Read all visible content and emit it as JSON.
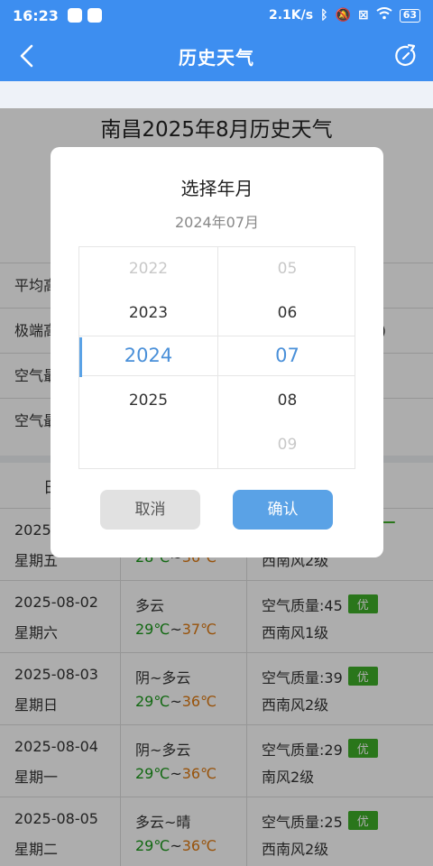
{
  "status_bar": {
    "time": "16:23",
    "network_speed": "2.1K/s",
    "battery": "63"
  },
  "nav": {
    "title": "历史天气"
  },
  "page": {
    "title": "南昌2025年8月历史天气"
  },
  "summary_rows": [
    {
      "label": "平均高"
    },
    {
      "label": "极端高",
      "suffix": ")"
    },
    {
      "label": "空气最"
    },
    {
      "label": "空气最"
    }
  ],
  "table": {
    "header": [
      "日"
    ],
    "rows": [
      {
        "date": "2025",
        "weekday": "星期五",
        "weather": "",
        "low": "28℃",
        "high": "36℃",
        "aqi": "",
        "aqi_level": "",
        "wind": "西南风2级"
      },
      {
        "date": "2025-08-02",
        "weekday": "星期六",
        "weather": "多云",
        "low": "29℃",
        "high": "37℃",
        "aqi": "空气质量:45",
        "aqi_level": "优",
        "wind": "西南风1级"
      },
      {
        "date": "2025-08-03",
        "weekday": "星期日",
        "weather": "阴~多云",
        "low": "29℃",
        "high": "36℃",
        "aqi": "空气质量:39",
        "aqi_level": "优",
        "wind": "西南风2级"
      },
      {
        "date": "2025-08-04",
        "weekday": "星期一",
        "weather": "阴~多云",
        "low": "29℃",
        "high": "36℃",
        "aqi": "空气质量:29",
        "aqi_level": "优",
        "wind": "南风2级"
      },
      {
        "date": "2025-08-05",
        "weekday": "星期二",
        "weather": "多云~晴",
        "low": "29℃",
        "high": "36℃",
        "aqi": "空气质量:25",
        "aqi_level": "优",
        "wind": "西南风2级"
      }
    ]
  },
  "dialog": {
    "title": "选择年月",
    "current": "2024年07月",
    "years": [
      "2022",
      "2023",
      "2024",
      "2025"
    ],
    "months": [
      "05",
      "06",
      "07",
      "08",
      "09"
    ],
    "selected_year": "2024",
    "selected_month": "07",
    "cancel_label": "取消",
    "confirm_label": "确认"
  },
  "colors": {
    "primary": "#3d8ef0",
    "accent": "#5aa2e6",
    "temp_low": "#1a9a1a",
    "temp_high": "#e07a10",
    "badge": "#3fae29"
  }
}
